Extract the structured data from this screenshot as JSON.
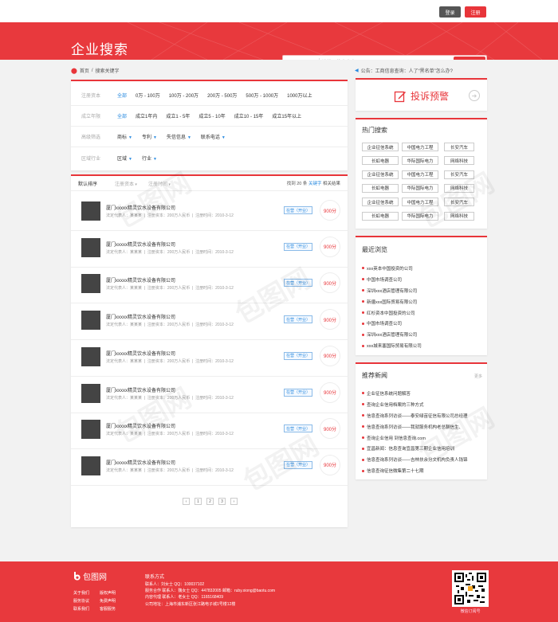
{
  "topbar": {
    "login": "登录",
    "register": "注册"
  },
  "banner": {
    "title": "企业搜索"
  },
  "search": {
    "type": "企业名称",
    "placeholder": "请输入搜索内容",
    "button": "搜索"
  },
  "breadcrumb": {
    "home": "首页",
    "sep": "/",
    "current": "搜索关键字"
  },
  "notice": {
    "text": "公告：工商信息查询：人了“黑名单”怎么办?"
  },
  "filters": {
    "capital": {
      "label": "注册资本",
      "options": [
        "全部",
        "0万 - 100万",
        "100万 - 200万",
        "200万 - 500万",
        "500万 - 1000万",
        "1000万以上"
      ]
    },
    "years": {
      "label": "成立年限",
      "options": [
        "全部",
        "成立1年内",
        "成立1 - 5年",
        "成立5 - 10年",
        "成立10 - 15年",
        "成立15年以上"
      ]
    },
    "advanced": {
      "label": "高级筛选",
      "options": [
        "商标",
        "专利",
        "失信信息",
        "联系电话"
      ]
    },
    "region": {
      "label": "区域行业",
      "options": [
        "区域",
        "行业"
      ]
    }
  },
  "list": {
    "sort_default": "默认排序",
    "sort_capital": "注册资本",
    "sort_date": "注册时间",
    "found_prefix": "找到 20 条",
    "found_keyword": "关键字",
    "found_suffix": "相关结果",
    "items": [
      {
        "name": "厦门xxxxx精灵饮水设备有限公司",
        "rep_label": "法定代表人：",
        "rep": "某某某",
        "capital_label": "注册资本：",
        "capital": "200万人民币",
        "date_label": "注册时间：",
        "date": "2010-3-12",
        "status": "在营（开业）",
        "score": "900分"
      },
      {
        "name": "厦门xxxxx精灵饮水设备有限公司",
        "rep_label": "法定代表人：",
        "rep": "某某某",
        "capital_label": "注册资本：",
        "capital": "200万人民币",
        "date_label": "注册时间：",
        "date": "2010-3-12",
        "status": "在营（开业）",
        "score": "900分"
      },
      {
        "name": "厦门xxxxx精灵饮水设备有限公司",
        "rep_label": "法定代表人：",
        "rep": "某某某",
        "capital_label": "注册资本：",
        "capital": "200万人民币",
        "date_label": "注册时间：",
        "date": "2010-3-12",
        "status": "在营（开业）",
        "score": "900分"
      },
      {
        "name": "厦门xxxxx精灵饮水设备有限公司",
        "rep_label": "法定代表人：",
        "rep": "某某某",
        "capital_label": "注册资本：",
        "capital": "200万人民币",
        "date_label": "注册时间：",
        "date": "2010-3-12",
        "status": "在营（开业）",
        "score": "900分"
      },
      {
        "name": "厦门xxxxx精灵饮水设备有限公司",
        "rep_label": "法定代表人：",
        "rep": "某某某",
        "capital_label": "注册资本：",
        "capital": "200万人民币",
        "date_label": "注册时间：",
        "date": "2010-3-12",
        "status": "在营（开业）",
        "score": "900分"
      },
      {
        "name": "厦门xxxxx精灵饮水设备有限公司",
        "rep_label": "法定代表人：",
        "rep": "某某某",
        "capital_label": "注册资本：",
        "capital": "200万人民币",
        "date_label": "注册时间：",
        "date": "2010-3-12",
        "status": "在营（开业）",
        "score": "900分"
      },
      {
        "name": "厦门xxxxx精灵饮水设备有限公司",
        "rep_label": "法定代表人：",
        "rep": "某某某",
        "capital_label": "注册资本：",
        "capital": "200万人民币",
        "date_label": "注册时间：",
        "date": "2010-3-12",
        "status": "在营（开业）",
        "score": "900分"
      },
      {
        "name": "厦门xxxxx精灵饮水设备有限公司",
        "rep_label": "法定代表人：",
        "rep": "某某某",
        "capital_label": "注册资本：",
        "capital": "200万人民币",
        "date_label": "注册时间：",
        "date": "2010-3-12",
        "status": "在营（开业）",
        "score": "900分"
      }
    ],
    "pager": [
      "‹",
      "1",
      "2",
      "3",
      "›"
    ]
  },
  "complain": {
    "label": "投诉预警"
  },
  "hot": {
    "title": "热门搜索",
    "tags": [
      [
        "企业征信系统",
        "中国电力工程",
        "长安汽车"
      ],
      [
        "长虹电器",
        "华际国际电力",
        "网络科技"
      ],
      [
        "企业征信系统",
        "中国电力工程",
        "长安汽车"
      ],
      [
        "长虹电器",
        "华际国际电力",
        "网络科技"
      ],
      [
        "企业征信系统",
        "中国电力工程",
        "长安汽车"
      ],
      [
        "长虹电器",
        "华际国际电力",
        "网络科技"
      ]
    ]
  },
  "recent": {
    "title": "最近浏览",
    "items": [
      "xxx英本中国投资的公司",
      "中国市场调查公司",
      "深圳xxx酒店管理有限公司",
      "新疆xxx国际贸易有限公司",
      "红杉资本中国投资的公司",
      "中国市场调查公司",
      "深圳xxx酒店管理有限公司",
      "xxx城来塞国际贸易有限公司"
    ]
  },
  "news": {
    "title": "推荐新闻",
    "more": "更多",
    "items": [
      "企业征信系统问题解答",
      "查询企业信用档案的三种方式",
      "信息查询系列访谈——泰安绿苗征信有限公司总经理",
      "信息查询系列访谈——我就服务机构老总聊信生、",
      "查询企业信用 到信息查询.com",
      "宜昌新闻：信息查询宜昌第三期企业信用培训",
      "信息查询系列访谈——吉林扶余分文机构负责人钱锦",
      "信息查询征信微集第二十七期"
    ]
  },
  "footer": {
    "logo": "包图网",
    "links": [
      "关于我们",
      "版权声明",
      "服务协议",
      "免费声明",
      "联系我们",
      "客服服务"
    ],
    "contact_title": "联系方式",
    "contact": [
      "联系人：刘女士   QQ：100037102",
      "服务合作  联系人：魏女士   QQ：447832005  邮箱：ruby.xiong@baotu.com",
      "内容代理  联系人：老女士   QQ：1165168409",
      "公司地址：上海市浦东新区张江路电子城1号楼12楼"
    ],
    "qr_label": "微信订阅号"
  },
  "watermark": "包图网"
}
